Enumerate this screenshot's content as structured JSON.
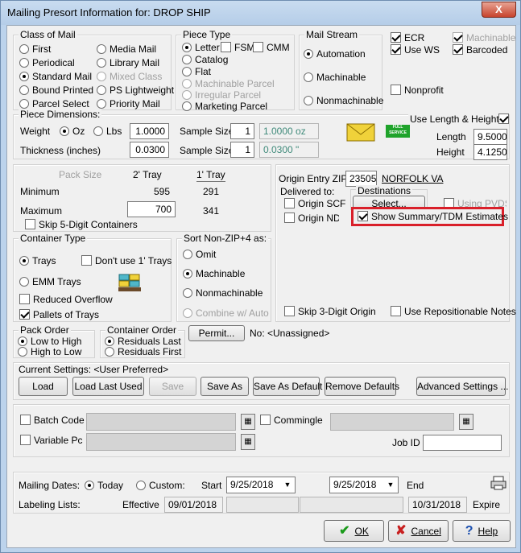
{
  "window": {
    "title": "Mailing Presort Information for: DROP SHIP",
    "close_glyph": "X"
  },
  "class_of_mail": {
    "label": "Class of Mail",
    "options": [
      "First",
      "Periodical",
      "Standard Mail",
      "Bound Printed",
      "Parcel Select",
      "Media Mail",
      "Library Mail",
      "Mixed Class",
      "PS Lightweight",
      "Priority Mail"
    ],
    "selected": "Standard Mail"
  },
  "piece_type": {
    "label": "Piece Type",
    "letter": "Letter",
    "fsm": "FSM",
    "cmm": "CMM",
    "catalog": "Catalog",
    "flat": "Flat",
    "machinable_parcel": "Machinable Parcel",
    "irregular_parcel": "Irregular Parcel",
    "marketing_parcel": "Marketing Parcel",
    "selected": "Letter"
  },
  "mail_stream": {
    "label": "Mail Stream",
    "automation": "Automation",
    "machinable": "Machinable",
    "nonmachinable": "Nonmachinable",
    "selected": "Automation"
  },
  "flags": {
    "ecr": "ECR",
    "use_ws": "Use WS",
    "machinable": "Machinable",
    "barcoded": "Barcoded",
    "nonprofit": "Nonprofit"
  },
  "piece_dimensions": {
    "label": "Piece Dimensions:",
    "weight_label": "Weight",
    "oz": "Oz",
    "lbs": "Lbs",
    "weight_value": "1.0000",
    "thickness_label": "Thickness (inches)",
    "thickness_value": "0.0300",
    "sample_size_label": "Sample Size",
    "sample_weight": "1",
    "sample_thickness": "1",
    "avg_weight": "1.0000 oz",
    "avg_thickness": "0.0300 \"",
    "use_lh": "Use Length & Height",
    "length_label": "Length",
    "length_value": "9.5000",
    "height_label": "Height",
    "height_value": "4.1250",
    "full_service": "FULL SERVICE"
  },
  "pack": {
    "pack_size": "Pack Size",
    "tray2": "2' Tray",
    "tray1": "1' Tray",
    "minimum": "Minimum",
    "min2": "595",
    "min1": "291",
    "maximum": "Maximum",
    "max2": "700",
    "max1": "341",
    "skip5": "Skip 5-Digit Containers"
  },
  "container_type": {
    "label": "Container Type",
    "trays": "Trays",
    "dont_use": "Don't use 1' Trays",
    "emm": "EMM Trays",
    "reduced": "Reduced Overflow",
    "pallets": "Pallets of Trays"
  },
  "sort_nonzip": {
    "label": "Sort Non-ZIP+4 as:",
    "omit": "Omit",
    "machinable": "Machinable",
    "nonmachinable": "Nonmachinable",
    "combine": "Combine w/ Auto"
  },
  "origin": {
    "entry_zip_label": "Origin Entry ZIP",
    "zip": "23505",
    "city": "NORFOLK VA",
    "delivered_to": "Delivered to:",
    "origin_scf": "Origin SCF",
    "origin_ndc": "Origin NDC",
    "destinations": "Destinations",
    "select": "Select...",
    "using_pvds": "Using PVDS",
    "show_summary": "Show Summary/TDM Estimates",
    "skip3": "Skip 3-Digit Origin",
    "use_repos": "Use Repositionable Notes"
  },
  "pack_order": {
    "label": "Pack Order",
    "low_high": "Low to High",
    "high_low": "High to Low"
  },
  "container_order": {
    "label": "Container Order",
    "residuals_last": "Residuals Last",
    "residuals_first": "Residuals First"
  },
  "permit": {
    "button": "Permit...",
    "value": "No: <Unassigned>"
  },
  "settings": {
    "current": "Current Settings: <User Preferred>",
    "load": "Load",
    "load_last": "Load Last Used",
    "save": "Save",
    "save_as": "Save As",
    "save_default": "Save As Default",
    "remove": "Remove Defaults",
    "advanced": "Advanced Settings ..."
  },
  "batch": {
    "batch_code": "Batch Code",
    "commingle": "Commingle",
    "variable_pc": "Variable Pc",
    "job_id": "Job ID"
  },
  "dates": {
    "mailing_dates": "Mailing Dates:",
    "today": "Today",
    "custom": "Custom:",
    "start": "Start",
    "start_date": "9/25/2018",
    "end_date": "9/25/2018",
    "end": "End",
    "labeling_lists": "Labeling Lists:",
    "effective": "Effective",
    "effective_date": "09/01/2018",
    "expire_date": "10/31/2018",
    "expire": "Expire"
  },
  "actions": {
    "ok": "OK",
    "cancel": "Cancel",
    "help": "Help"
  },
  "colors": {
    "highlight": "#d9202a",
    "ok_check": "#1a9a1a",
    "cancel_x": "#c82020",
    "help_q": "#1a4fb0"
  }
}
